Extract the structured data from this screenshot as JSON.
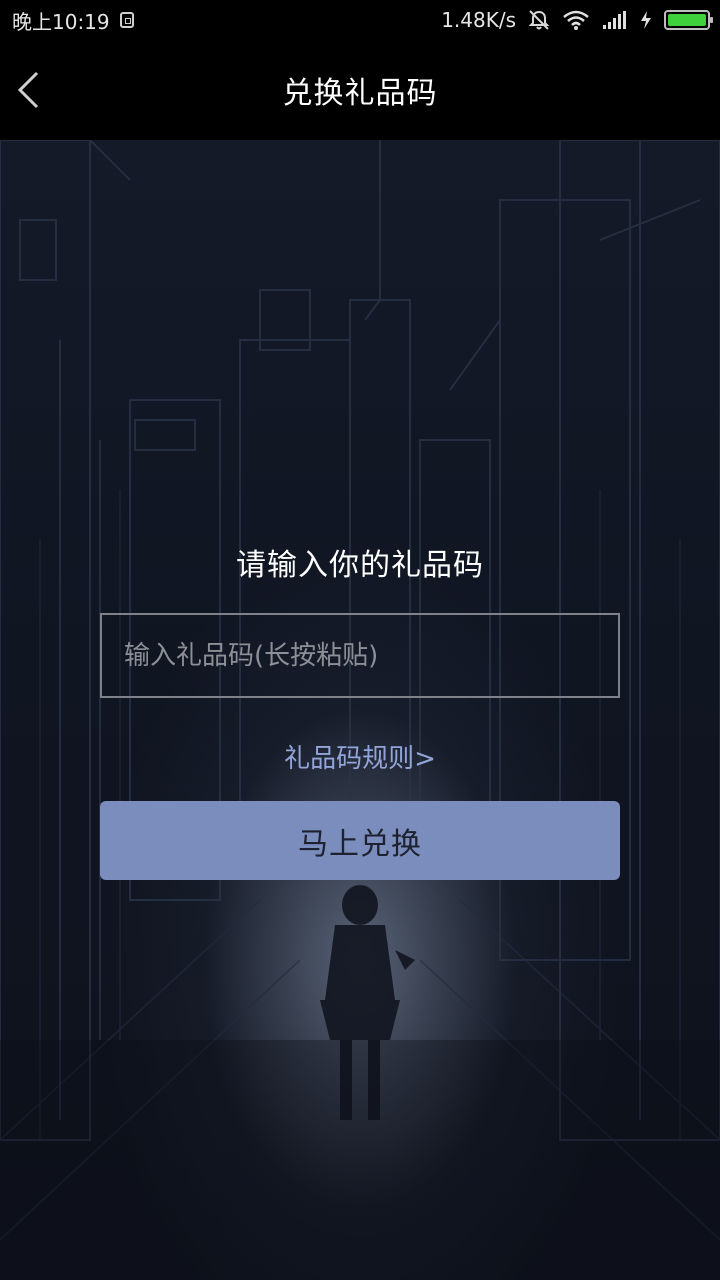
{
  "status_bar": {
    "time": "晚上10:19",
    "network_speed": "1.48K/s",
    "icons": [
      "sim-icon",
      "bell-muted-icon",
      "wifi-icon",
      "signal-icon",
      "charging-icon",
      "battery-icon"
    ],
    "battery_color": "#3fd13b"
  },
  "header": {
    "title": "兑换礼品码",
    "back_icon": "chevron-left-icon"
  },
  "main": {
    "prompt": "请输入你的礼品码",
    "code_input": {
      "placeholder": "输入礼品码(长按粘贴)",
      "value": ""
    },
    "rules_link": "礼品码规则>",
    "redeem_button": "马上兑换"
  },
  "colors": {
    "accent": "#7b8dbc",
    "link": "#93a5d8",
    "header_bg": "#000000"
  }
}
